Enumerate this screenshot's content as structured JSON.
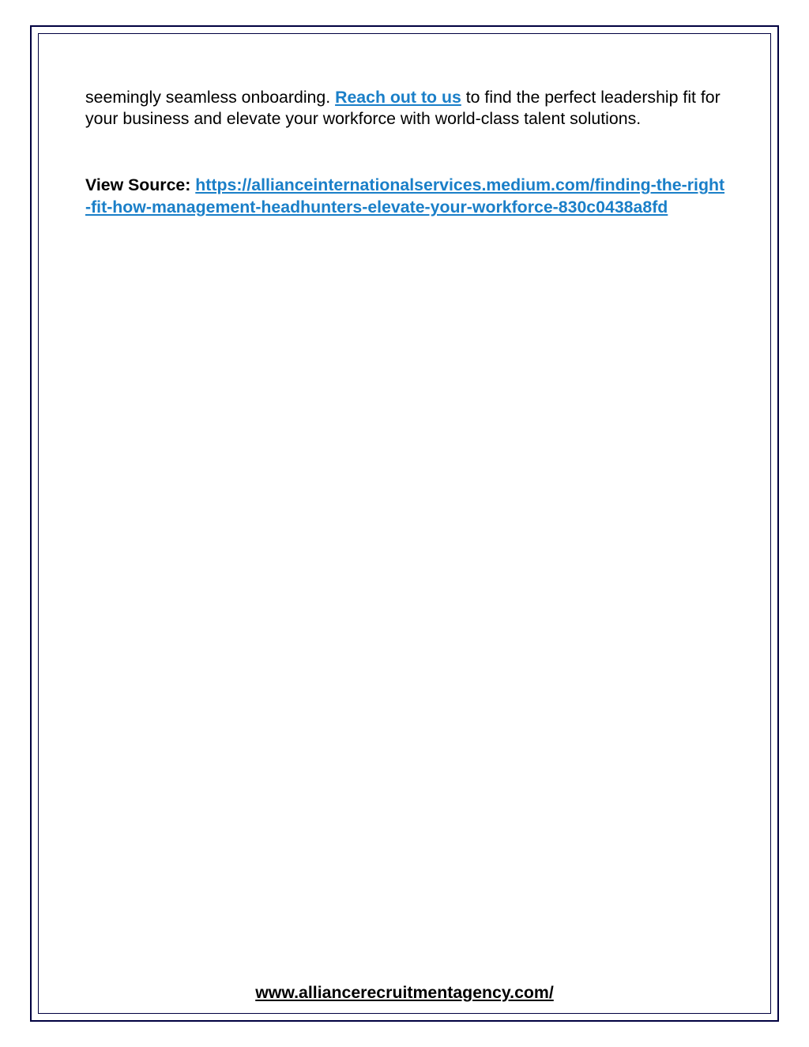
{
  "paragraph1": {
    "textBefore": "seemingly seamless onboarding. ",
    "linkText": "Reach out to us",
    "textAfter": " to find the perfect leadership fit for your business and elevate your workforce with world-class talent solutions."
  },
  "paragraph2": {
    "label": "View Source: ",
    "linkText": "https://allianceinternationalservices.medium.com/finding-the-right-fit-how-management-headhunters-elevate-your-workforce-830c0438a8fd"
  },
  "footer": {
    "linkText": "www.alliancerecruitmentagency.com/"
  }
}
